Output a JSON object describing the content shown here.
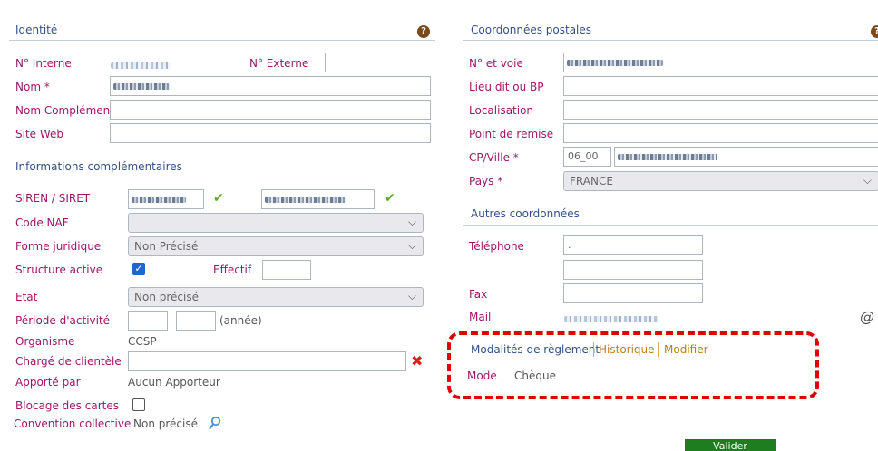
{
  "identite": {
    "title": "Identité",
    "n_interne_label": "N° Interne",
    "n_externe_label": "N° Externe",
    "nom_label": "Nom *",
    "nom_complement_label": "Nom Complément",
    "site_web_label": "Site Web"
  },
  "infos": {
    "title": "Informations complémentaires",
    "siren_label": "SIREN / SIRET",
    "code_naf_label": "Code NAF",
    "forme_juridique_label": "Forme juridique",
    "forme_juridique_value": "Non Précisé",
    "structure_active_label": "Structure active",
    "effectif_label": "Effectif",
    "etat_label": "Etat",
    "etat_value": "Non précisé",
    "periode_label": "Période d'activité",
    "annee_label": "(année)",
    "organisme_label": "Organisme",
    "organisme_value": "CCSP",
    "charge_label": "Chargé de clientèle",
    "apporte_label": "Apporté par",
    "apporte_value": "Aucun Apporteur",
    "blocage_label": "Blocage des cartes",
    "convention_label": "Convention collective",
    "convention_value": "Non précisé"
  },
  "postales": {
    "title": "Coordonnées postales",
    "voie_label": "N° et voie",
    "lieu_dit_label": "Lieu dit ou BP",
    "localisation_label": "Localisation",
    "point_remise_label": "Point de remise",
    "cp_ville_label": "CP/Ville *",
    "cp_value": "06_00",
    "pays_label": "Pays *",
    "pays_value": "FRANCE"
  },
  "autres": {
    "title": "Autres coordonnées",
    "telephone_label": "Téléphone",
    "telephone_value": ".",
    "fax_label": "Fax",
    "mail_label": "Mail"
  },
  "reglement": {
    "tab_modalites": "Modalités de règlement",
    "tab_historique": "Historique",
    "tab_modifier": "Modifier",
    "mode_label": "Mode",
    "mode_value": "Chèque"
  },
  "footer": {
    "valider_label": "Valider"
  },
  "colors": {
    "label": "#a0156a",
    "section": "#33508a",
    "tab": "#c47d1a",
    "highlight_border": "#e00000",
    "button": "#1e7d1e"
  },
  "icons": [
    "help-icon",
    "check-icon",
    "chevron-down-icon",
    "clear-x-icon",
    "search-icon",
    "mail-at-icon"
  ]
}
